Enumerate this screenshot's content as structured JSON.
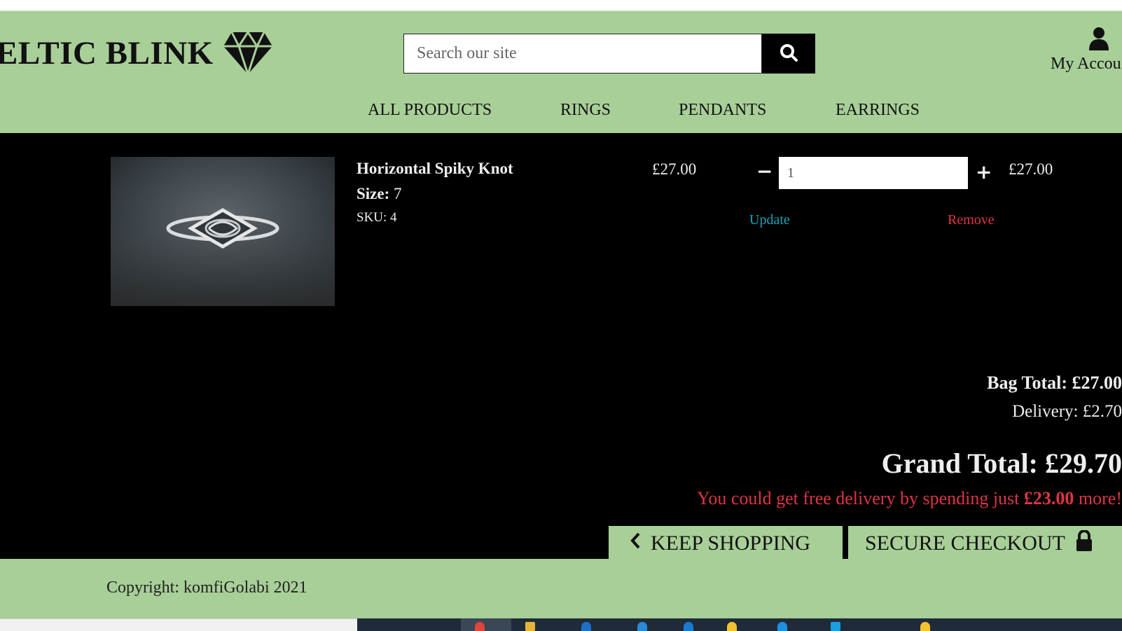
{
  "brand": {
    "name": "ELTIC BLINK"
  },
  "search": {
    "placeholder": "Search our site"
  },
  "account": {
    "label": "My Accou"
  },
  "nav": [
    {
      "label": "ALL PRODUCTS"
    },
    {
      "label": "RINGS"
    },
    {
      "label": "PENDANTS"
    },
    {
      "label": "EARRINGS"
    }
  ],
  "bag": {
    "item": {
      "name": "Horizontal Spiky Knot",
      "size_label": "Size:",
      "size_value": "7",
      "sku": "SKU: 4",
      "price": "£27.00",
      "quantity": "1",
      "subtotal": "£27.00",
      "update_label": "Update",
      "remove_label": "Remove"
    },
    "bag_total": "Bag Total: £27.00",
    "delivery": "Delivery: £2.70",
    "grand_total": "Grand Total: £29.70",
    "free_delivery": {
      "prefix": "You could get free delivery by spending just ",
      "amount": "£23.00",
      "suffix": " more!"
    },
    "keep_shopping_label": "KEEP SHOPPING",
    "checkout_label": "SECURE CHECKOUT"
  },
  "footer": {
    "copyright": "Copyright: komfiGolabi 2021"
  },
  "colors": {
    "accent": "#a8cf98",
    "danger": "#dc3545",
    "info": "#17a2b8",
    "background": "#000000"
  }
}
